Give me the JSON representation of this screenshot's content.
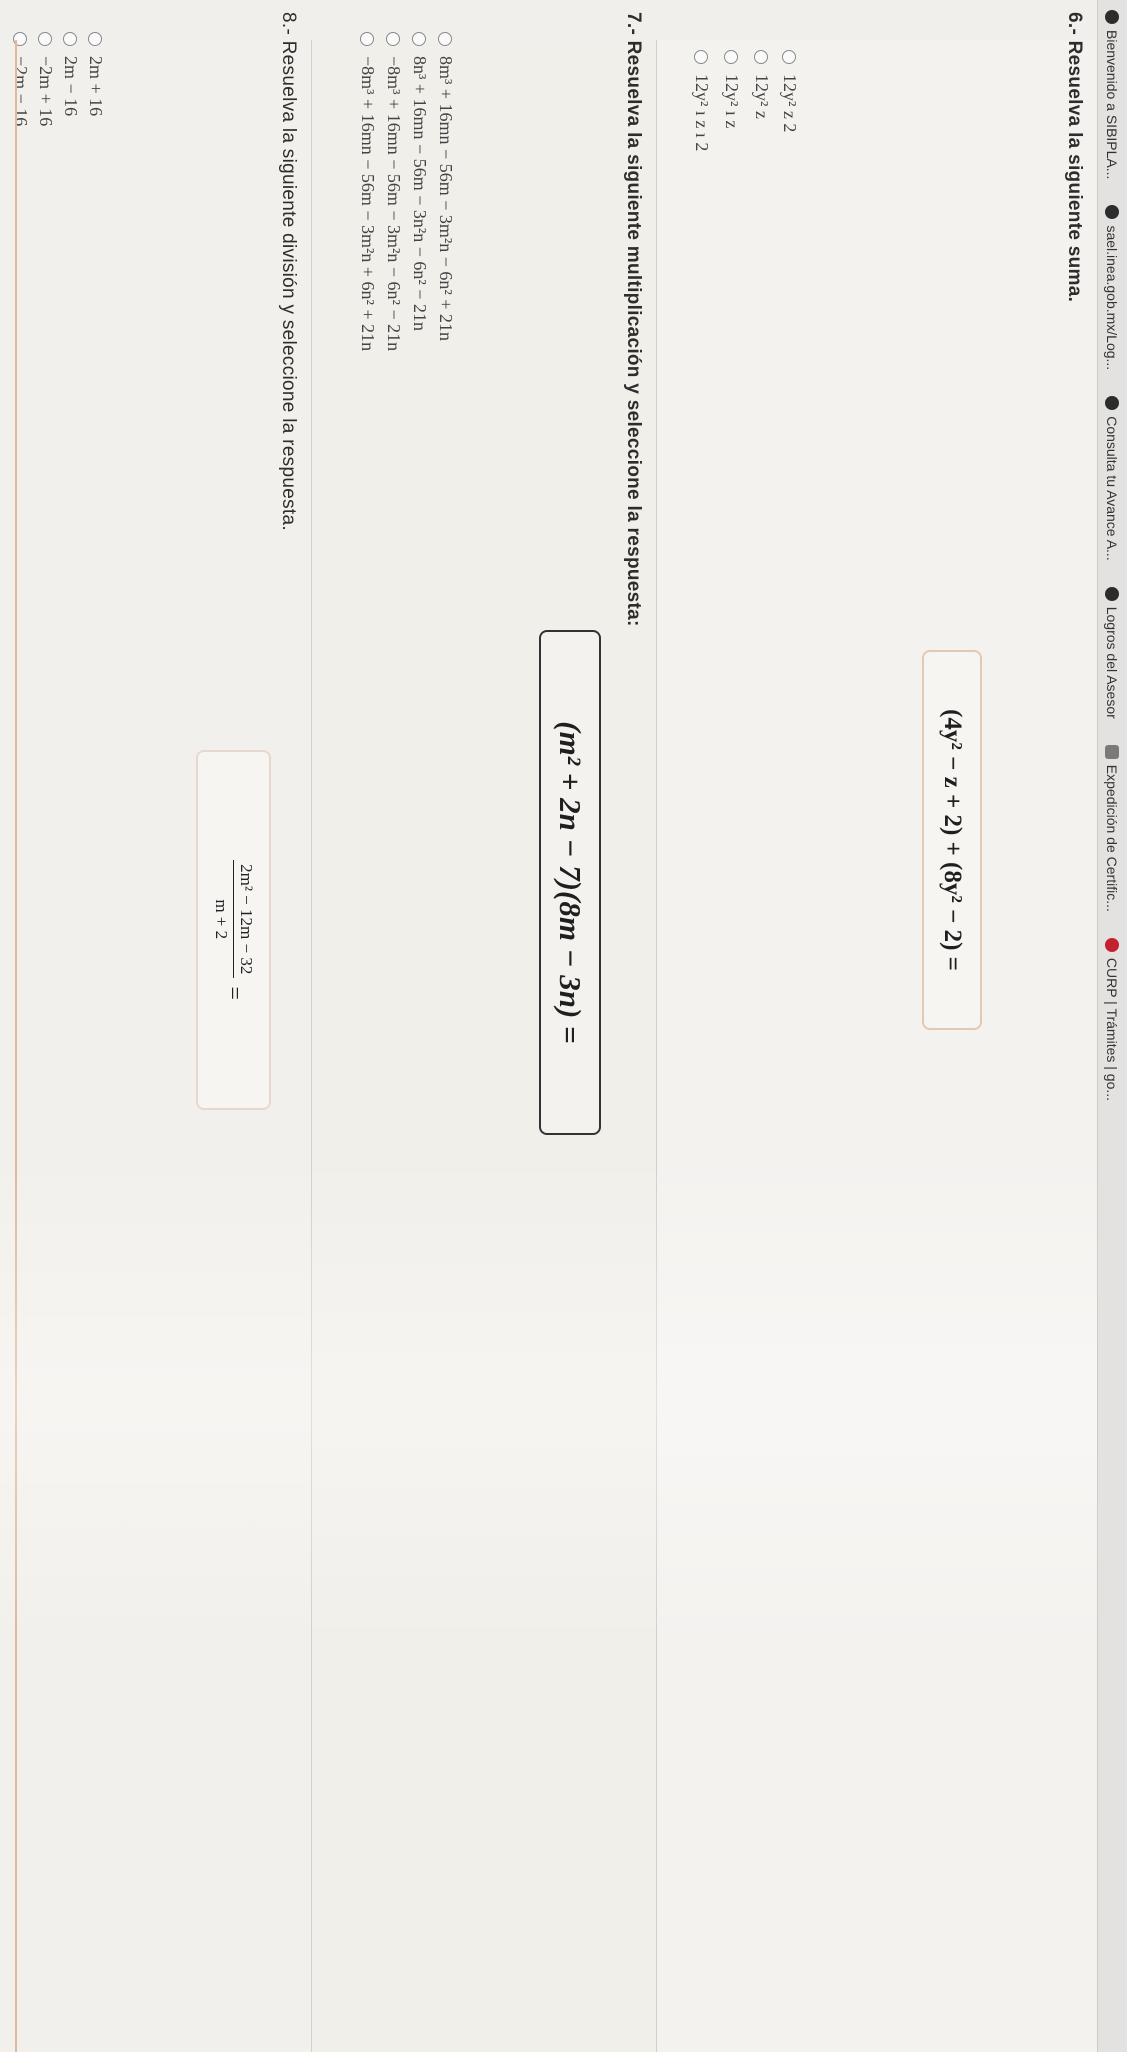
{
  "bookmarks": [
    {
      "label": "Bienvenido a SIBIPLA...",
      "icon": "sibipla-icon"
    },
    {
      "label": "sael.inea.gob.mx/Log...",
      "icon": "inea-icon"
    },
    {
      "label": "Consulta tu Avance A...",
      "icon": "inea-icon"
    },
    {
      "label": "Logros del Asesor",
      "icon": "inea-icon"
    },
    {
      "label": "Expedición de Certific...",
      "icon": "certificate-icon"
    },
    {
      "label": "CURP | Trámites | go...",
      "icon": "gob-icon"
    }
  ],
  "q6": {
    "title": "6.- Resuelva la siguiente suma.",
    "expression": "(4y² − z + 2) + (8y² − 2) =",
    "options": [
      "12y²  z  2",
      "12y²  z",
      "12y²  ı  z",
      "12y²  ı  z  ı  2"
    ]
  },
  "q7": {
    "title": "7.- Resuelva la siguiente multiplicación y seleccione la respuesta:",
    "expression": "(m² + 2n − 7)(8m − 3n) =",
    "options": [
      "8m³ + 16mn − 56m − 3m²n − 6n² + 21n",
      "8n³ + 16mn − 56m − 3n²n − 6n² − 21n",
      "−8m³ + 16mn − 56m − 3m²n − 6n² − 21n",
      "−8m³ + 16mn − 56m − 3m²n + 6n² + 21n"
    ]
  },
  "q8": {
    "title": "8.- Resuelva la siguiente división y seleccione la respuesta.",
    "numerator": "2m² − 12m − 32",
    "denominator": "m + 2",
    "equals": "=",
    "options": [
      "2m + 16",
      "2m − 16",
      "−2m + 16",
      "−2m − 16"
    ]
  }
}
